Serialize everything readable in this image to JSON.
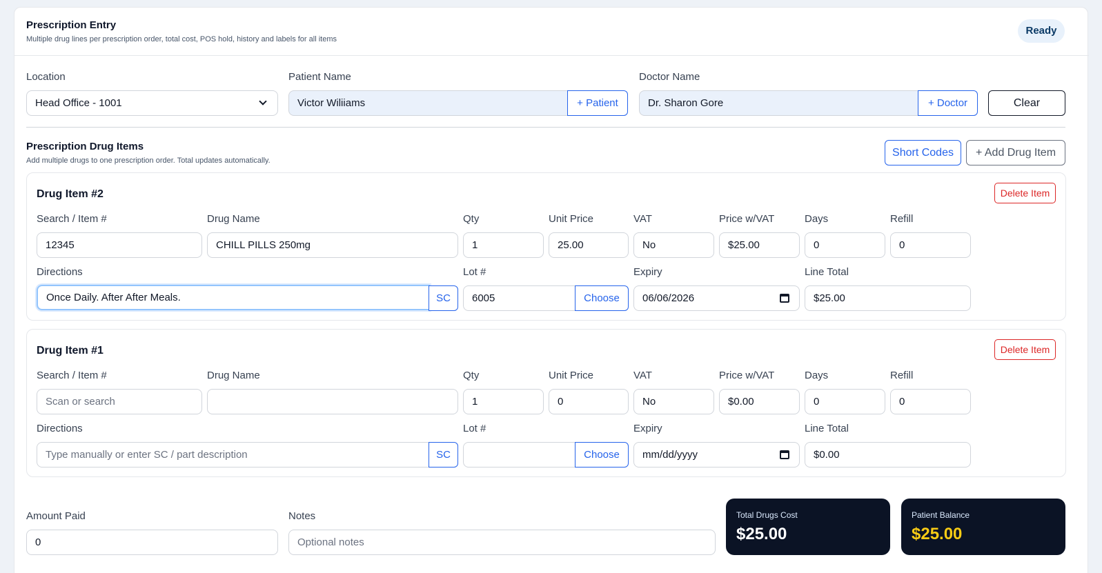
{
  "header": {
    "title": "Prescription Entry",
    "subtitle": "Multiple drug lines per prescription order, total cost, POS hold, history and labels for all items",
    "status": "Ready"
  },
  "top_fields": {
    "location_label": "Location",
    "location_value": "Head Office - 1001",
    "patient_label": "Patient Name",
    "patient_value": "Victor Wiliiams",
    "add_patient": "+ Patient",
    "doctor_label": "Doctor Name",
    "doctor_value": "Dr. Sharon Gore",
    "add_doctor": "+ Doctor",
    "clear": "Clear"
  },
  "items_section": {
    "title": "Prescription Drug Items",
    "subtitle": "Add multiple drugs to one prescription order. Total updates automatically.",
    "short_codes": "Short Codes",
    "add_item": "+ Add Drug Item"
  },
  "labels": {
    "search": "Search / Item #",
    "drug_name": "Drug Name",
    "qty": "Qty",
    "unit_price": "Unit Price",
    "vat": "VAT",
    "price_vat": "Price w/VAT",
    "days": "Days",
    "refill": "Refill",
    "directions": "Directions",
    "lot": "Lot #",
    "expiry": "Expiry",
    "line_total": "Line Total",
    "sc": "SC",
    "choose": "Choose",
    "delete": "Delete Item"
  },
  "items": [
    {
      "title": "Drug Item #2",
      "search": "12345",
      "search_placeholder": "",
      "drug_name": "CHILL PILLS 250mg",
      "qty": "1",
      "unit_price": "25.00",
      "vat": "No",
      "price_vat": "$25.00",
      "days": "0",
      "refill": "0",
      "directions": "Once Daily. After After Meals.",
      "directions_placeholder": "",
      "lot": "6005",
      "expiry": "06/06/2026",
      "line_total": "$25.00"
    },
    {
      "title": "Drug Item #1",
      "search": "",
      "search_placeholder": "Scan or search",
      "drug_name": "",
      "qty": "1",
      "unit_price": "0",
      "vat": "No",
      "price_vat": "$0.00",
      "days": "0",
      "refill": "0",
      "directions": "",
      "directions_placeholder": "Type manually or enter SC / part description",
      "lot": "",
      "expiry": "mm/dd/yyyy",
      "line_total": "$0.00"
    }
  ],
  "footer": {
    "amount_paid_label": "Amount Paid",
    "amount_paid": "0",
    "notes_label": "Notes",
    "notes_placeholder": "Optional notes",
    "total_label": "Total Drugs Cost",
    "total_value": "$25.00",
    "balance_label": "Patient Balance",
    "balance_value": "$25.00",
    "balance_color": "#facc15"
  }
}
